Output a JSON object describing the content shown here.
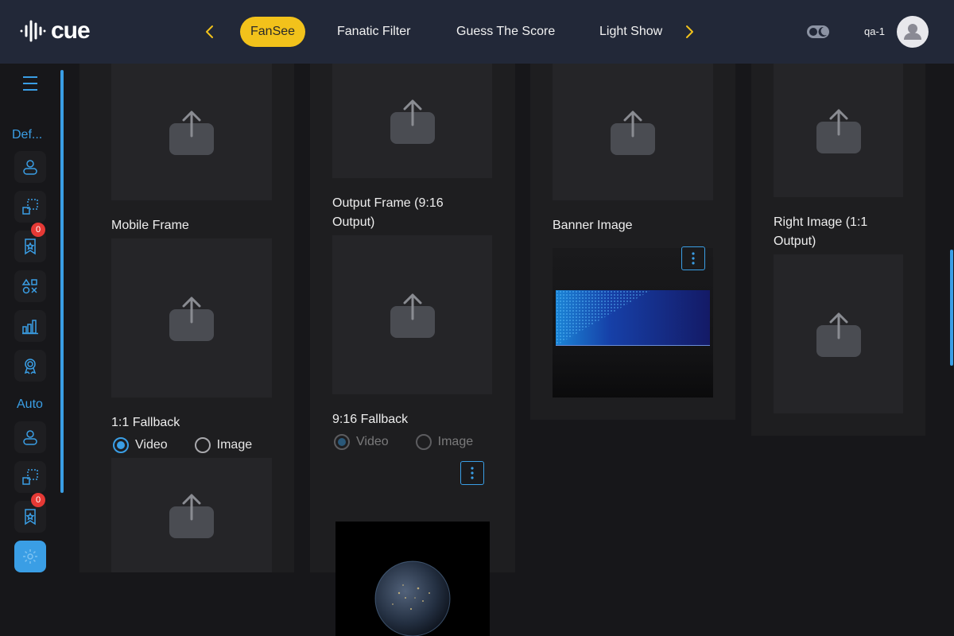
{
  "app": {
    "logo_text": "cue",
    "logo_icon": "soundwave-icon"
  },
  "nav": {
    "tabs": [
      {
        "label": "FanSee",
        "active": true
      },
      {
        "label": "Fanatic Filter",
        "active": false
      },
      {
        "label": "Guess The Score",
        "active": false
      },
      {
        "label": "Light Show",
        "active": false
      }
    ],
    "prev_icon": "chevron-left-icon",
    "next_icon": "chevron-right-icon"
  },
  "user": {
    "username": "qa-1",
    "avatar_icon": "user-avatar-icon",
    "theme_icon": "theme-toggle-icon"
  },
  "sidebar": {
    "menu_icon": "hamburger-icon",
    "sections": [
      {
        "label": "Def...",
        "items": [
          {
            "icon": "user-icon"
          },
          {
            "icon": "frames-icon"
          },
          {
            "icon": "bookmark-star-icon",
            "badge": "0"
          },
          {
            "icon": "shapes-icon"
          },
          {
            "icon": "bar-chart-icon"
          },
          {
            "icon": "award-icon"
          }
        ]
      },
      {
        "label": "Auto",
        "items": [
          {
            "icon": "user-icon"
          },
          {
            "icon": "frames-icon"
          },
          {
            "icon": "bookmark-star-icon",
            "badge": "0"
          },
          {
            "icon": "settings-icon",
            "active": true
          }
        ]
      }
    ]
  },
  "columns": {
    "col1": {
      "mobile_frame_label": "Mobile Frame",
      "fallback_label": "1:1 Fallback",
      "radio_video": "Video",
      "radio_image": "Image",
      "selected": "Video"
    },
    "col2": {
      "output_frame_label": "Output Frame (9:16 Output)",
      "fallback_label": "9:16 Fallback",
      "radio_video": "Video",
      "radio_image": "Image",
      "selected": "Video",
      "disabled": true
    },
    "col3": {
      "banner_label": "Banner Image"
    },
    "col4": {
      "right_image_label": "Right Image (1:1 Output)"
    }
  },
  "colors": {
    "accent": "#3a9ee5",
    "active_tab": "#f2c21b",
    "topbar": "#222838",
    "badge": "#e53935"
  }
}
